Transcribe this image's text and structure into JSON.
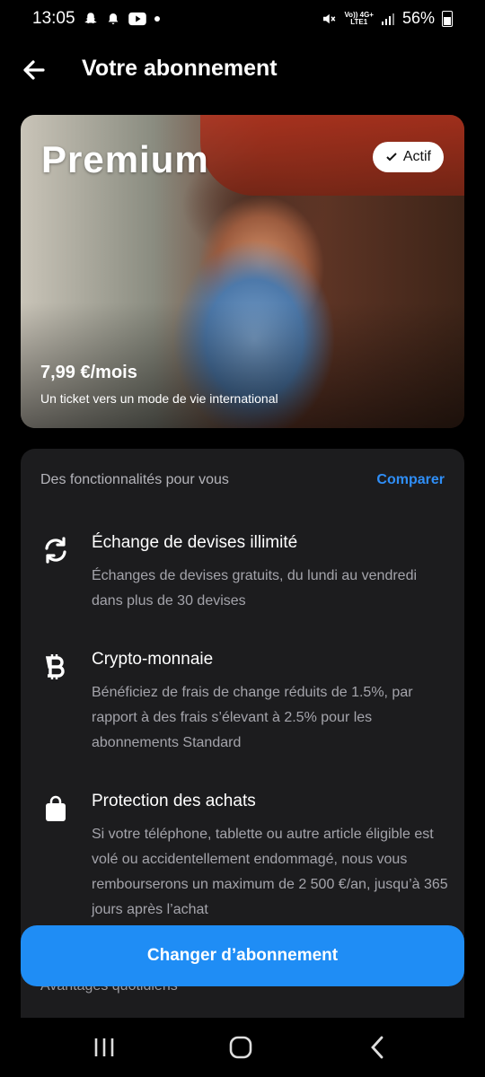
{
  "status_bar": {
    "time": "13:05",
    "network_top": "Vo)) 4G+",
    "network_bottom": "LTE1",
    "battery": "56%"
  },
  "header": {
    "title": "Votre abonnement",
    "back_icon": "arrow-left-icon"
  },
  "plan_card": {
    "name": "Premium",
    "badge": "Actif",
    "price": "7,99 €/mois",
    "tagline": "Un ticket vers un mode de vie international"
  },
  "features": {
    "heading": "Des fonctionnalités pour vous",
    "compare_link": "Comparer",
    "items": [
      {
        "icon": "exchange-icon",
        "title": "Échange de devises illimité",
        "description": "Échanges de devises gratuits, du lundi au vendredi dans plus de 30 devises"
      },
      {
        "icon": "bitcoin-icon",
        "title": "Crypto-monnaie",
        "description": "Bénéficiez de frais de change réduits de 1.5%, par rapport à des frais s’élevant à 2.5% pour les abonnements Standard"
      },
      {
        "icon": "shopping-bag-icon",
        "title": "Protection des achats",
        "description": "Si votre téléphone, tablette ou autre article éligible est volé ou accidentellement endommagé, nous vous rembourserons un maximum de 2 500 €/an, jusqu’à 365 jours après l’achat"
      }
    ],
    "next_section": "Avantages quotidiens"
  },
  "cta": {
    "label": "Changer d’abonnement"
  },
  "colors": {
    "accent": "#1f8df5",
    "panel": "#1c1c1e",
    "background": "#000000"
  }
}
